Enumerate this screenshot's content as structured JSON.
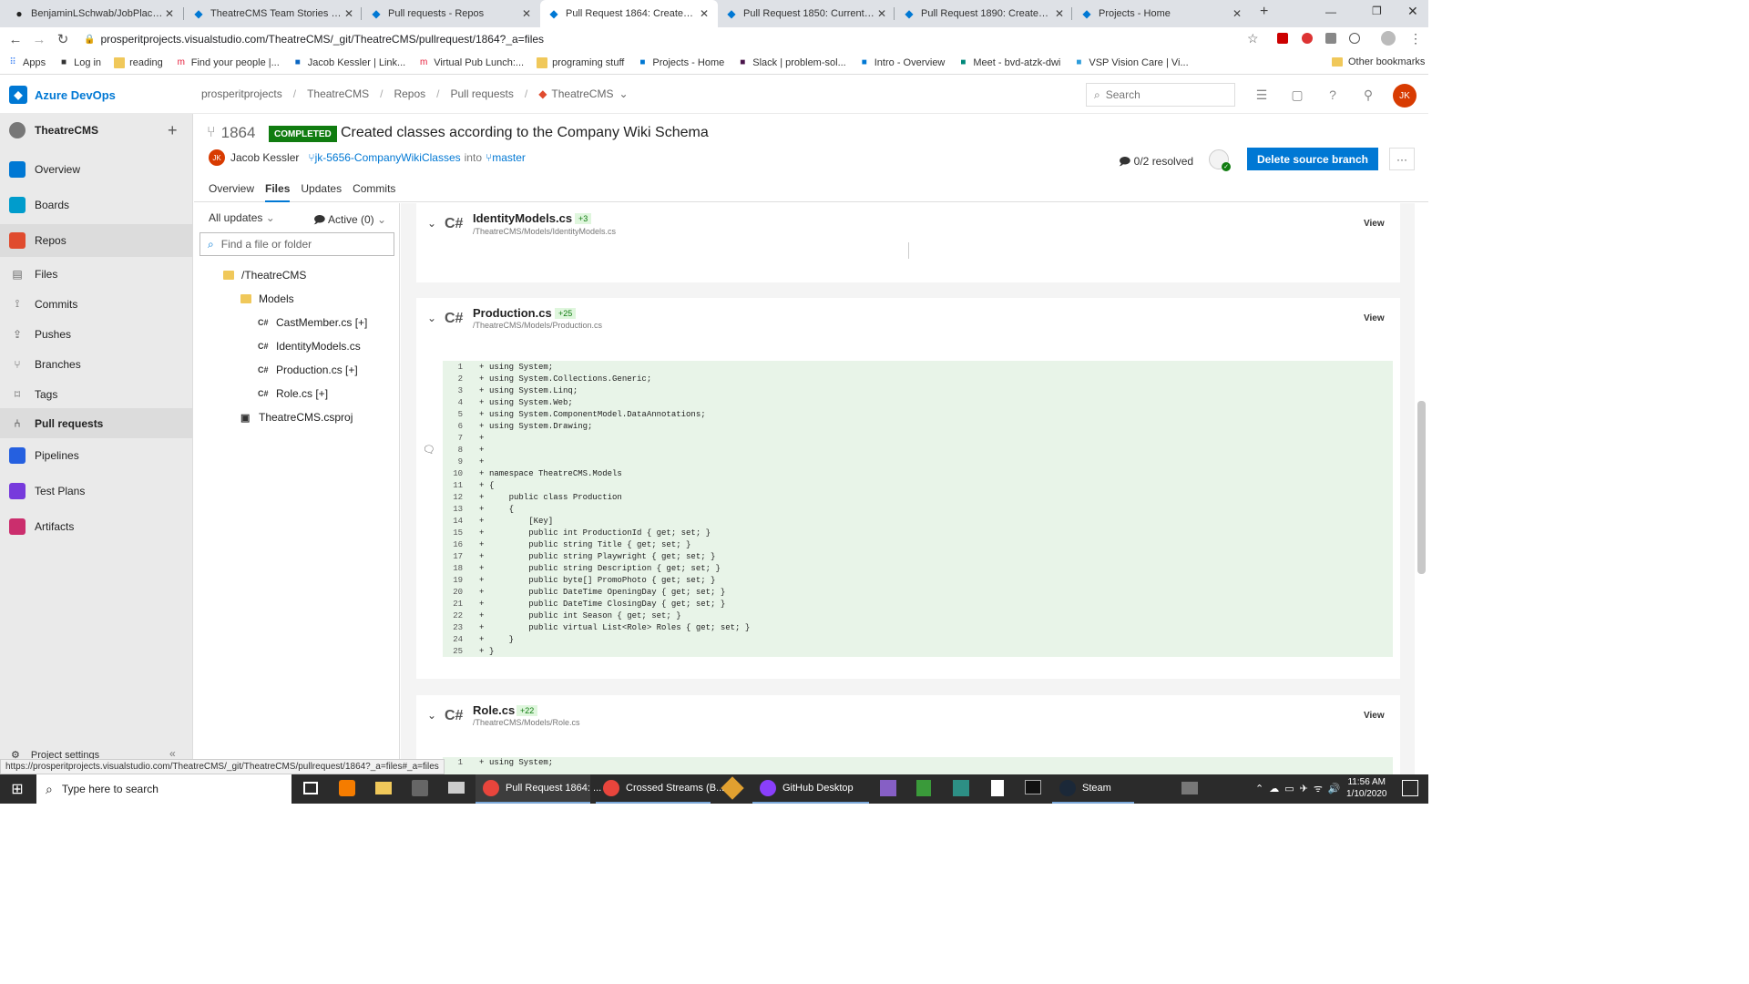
{
  "browser": {
    "tabs": [
      {
        "title": "BenjaminLSchwab/JobPlacement",
        "icon": "github-icon",
        "active": false
      },
      {
        "title": "TheatreCMS Team Stories Board",
        "icon": "azure-devops-icon",
        "active": false
      },
      {
        "title": "Pull requests - Repos",
        "icon": "azure-devops-icon",
        "active": false
      },
      {
        "title": "Pull Request 1864: Created classe",
        "icon": "azure-devops-icon",
        "active": true
      },
      {
        "title": "Pull Request 1850: Current Produ",
        "icon": "azure-devops-icon",
        "active": false
      },
      {
        "title": "Pull Request 1890: Created Db Ac",
        "icon": "azure-devops-icon",
        "active": false
      },
      {
        "title": "Projects - Home",
        "icon": "azure-devops-icon",
        "active": false
      }
    ],
    "url": "prosperitprojects.visualstudio.com/TheatreCMS/_git/TheatreCMS/pullrequest/1864?_a=files",
    "bookmarks": [
      {
        "label": "Apps",
        "icon": "apps-grid-icon"
      },
      {
        "label": "Log in",
        "icon": "log-in-icon"
      },
      {
        "label": "reading",
        "icon": "folder-icon"
      },
      {
        "label": "Find your people |...",
        "icon": "meetup-icon"
      },
      {
        "label": "Jacob Kessler | Link...",
        "icon": "linkedin-icon"
      },
      {
        "label": "Virtual Pub Lunch:...",
        "icon": "meetup-icon"
      },
      {
        "label": "programing stuff",
        "icon": "folder-icon"
      },
      {
        "label": "Projects - Home",
        "icon": "azure-devops-icon"
      },
      {
        "label": "Slack | problem-sol...",
        "icon": "slack-icon"
      },
      {
        "label": "Intro - Overview",
        "icon": "azure-devops-icon"
      },
      {
        "label": "Meet - bvd-atzk-dwi",
        "icon": "meet-icon"
      },
      {
        "label": "VSP Vision Care | Vi...",
        "icon": "vsp-icon"
      }
    ],
    "other_bookmarks": "Other bookmarks",
    "status_url": "https://prosperitprojects.visualstudio.com/TheatreCMS/_git/TheatreCMS/pullrequest/1864?_a=files#_a=files"
  },
  "header": {
    "brand": "Azure DevOps",
    "breadcrumbs": [
      "prosperitprojects",
      "TheatreCMS",
      "Repos",
      "Pull requests"
    ],
    "repo": "TheatreCMS",
    "search_placeholder": "Search",
    "user_initials": "JK"
  },
  "sidebar": {
    "project": "TheatreCMS",
    "items": [
      {
        "label": "Overview",
        "icon": "overview-icon",
        "color": "#0078d4"
      },
      {
        "label": "Boards",
        "icon": "boards-icon",
        "color": "#009ccc"
      },
      {
        "label": "Repos",
        "icon": "repos-icon",
        "color": "#e04b2e"
      },
      {
        "label": "Files",
        "icon": "files-icon"
      },
      {
        "label": "Commits",
        "icon": "commits-icon"
      },
      {
        "label": "Pushes",
        "icon": "pushes-icon"
      },
      {
        "label": "Branches",
        "icon": "branches-icon"
      },
      {
        "label": "Tags",
        "icon": "tags-icon"
      },
      {
        "label": "Pull requests",
        "icon": "pull-requests-icon"
      },
      {
        "label": "Pipelines",
        "icon": "pipelines-icon",
        "color": "#2560e0"
      },
      {
        "label": "Test Plans",
        "icon": "test-plans-icon",
        "color": "#773adc"
      },
      {
        "label": "Artifacts",
        "icon": "artifacts-icon",
        "color": "#cb2e6d"
      }
    ],
    "settings": "Project settings"
  },
  "pr": {
    "id": "1864",
    "status": "COMPLETED",
    "title": "Created classes according to the Company Wiki Schema",
    "author": "Jacob Kessler",
    "author_initials": "JK",
    "source_branch": "jk-5656-CompanyWikiClasses",
    "into": "into",
    "target_branch": "master",
    "tabs": [
      "Overview",
      "Files",
      "Updates",
      "Commits"
    ],
    "resolved": "0/2 resolved",
    "delete_button": "Delete source branch",
    "more": "···"
  },
  "files_panel": {
    "updates_select": "All updates",
    "active_select": "Active (0)",
    "find_placeholder": "Find a file or folder",
    "tree": [
      {
        "label": "/TheatreCMS",
        "type": "folder"
      },
      {
        "label": "Models",
        "type": "folder"
      },
      {
        "label": "CastMember.cs [+]",
        "type": "cs"
      },
      {
        "label": "IdentityModels.cs",
        "type": "cs"
      },
      {
        "label": "Production.cs [+]",
        "type": "cs"
      },
      {
        "label": "Role.cs [+]",
        "type": "cs"
      },
      {
        "label": "TheatreCMS.csproj",
        "type": "csproj"
      }
    ]
  },
  "diffs": [
    {
      "name": "IdentityModels.cs",
      "added": "+3",
      "path": "/TheatreCMS/Models/IdentityModels.cs",
      "view": "View"
    },
    {
      "name": "Production.cs",
      "added": "+25",
      "path": "/TheatreCMS/Models/Production.cs",
      "view": "View"
    },
    {
      "name": "Role.cs",
      "added": "+22",
      "path": "/TheatreCMS/Models/Role.cs",
      "view": "View"
    }
  ],
  "lang_label": "C#",
  "production_code": [
    "using System;",
    "using System.Collections.Generic;",
    "using System.Linq;",
    "using System.Web;",
    "using System.ComponentModel.DataAnnotations;",
    "using System.Drawing;",
    "",
    "",
    "",
    "namespace TheatreCMS.Models",
    "{",
    "    public class Production",
    "    {",
    "        [Key]",
    "        public int ProductionId { get; set; }",
    "        public string Title { get; set; }",
    "        public string Playwright { get; set; }",
    "        public string Description { get; set; }",
    "        public byte[] PromoPhoto { get; set; }",
    "        public DateTime OpeningDay { get; set; }",
    "        public DateTime ClosingDay { get; set; }",
    "        public int Season { get; set; }",
    "        public virtual List<Role> Roles { get; set; }",
    "    }",
    "}"
  ],
  "role_code_first": "using System;",
  "taskbar": {
    "search_placeholder": "Type here to search",
    "apps": [
      {
        "label": "Pull Request 1864: ...",
        "icon": "chrome-icon",
        "color": "#e8453c"
      },
      {
        "label": "Crossed Streams (B...",
        "icon": "chrome-icon",
        "color": "#e8453c"
      },
      {
        "label": "GitHub Desktop",
        "icon": "github-desktop-icon",
        "color": "#8a3ffc"
      },
      {
        "label": "Steam",
        "icon": "steam-icon",
        "color": "#1b2838"
      }
    ],
    "time": "11:56 AM",
    "date": "1/10/2020"
  }
}
